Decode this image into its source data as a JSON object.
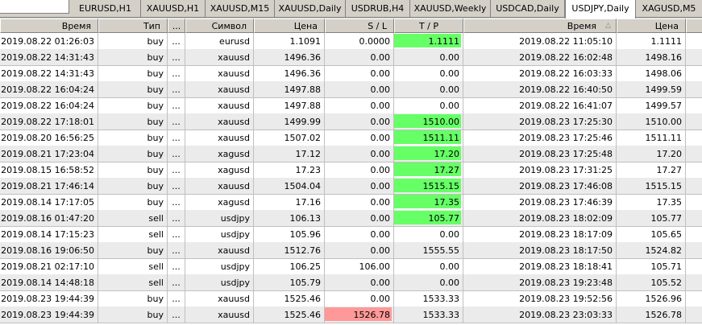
{
  "tabs": [
    {
      "label": "EURUSD,H1"
    },
    {
      "label": "XAUUSD,H1"
    },
    {
      "label": "XAUUSD,M15"
    },
    {
      "label": "XAUUSD,Daily"
    },
    {
      "label": "USDRUB,H4"
    },
    {
      "label": "XAUUSD,Weekly"
    },
    {
      "label": "USDCAD,Daily"
    },
    {
      "label": "USDJPY,Daily"
    },
    {
      "label": "XAGUSD,M5"
    }
  ],
  "active_tab": "USDJPY,Daily",
  "columns": [
    "Время",
    "Тип",
    "...",
    "Символ",
    "Цена",
    "S / L",
    "T / P",
    "Время",
    "Цена"
  ],
  "sorted_column_icon": "sort-up-icon",
  "colors": {
    "tp_hit": "#66ff66",
    "sl_hit": "#ff9999"
  },
  "rows": [
    {
      "open_time": "2019.08.22 01:26:03",
      "type": "buy",
      "dots": "...",
      "symbol": "eurusd",
      "price": "1.1091",
      "sl": "0.0000",
      "tp": "1.1111",
      "close_time": "2019.08.22 11:05:10",
      "close_price": "1.1111",
      "hl": "tp"
    },
    {
      "open_time": "2019.08.22 14:31:43",
      "type": "buy",
      "dots": "...",
      "symbol": "xauusd",
      "price": "1496.36",
      "sl": "0.00",
      "tp": "0.00",
      "close_time": "2019.08.22 16:02:48",
      "close_price": "1498.16",
      "hl": ""
    },
    {
      "open_time": "2019.08.22 14:31:43",
      "type": "buy",
      "dots": "...",
      "symbol": "xauusd",
      "price": "1496.36",
      "sl": "0.00",
      "tp": "0.00",
      "close_time": "2019.08.22 16:03:33",
      "close_price": "1498.06",
      "hl": ""
    },
    {
      "open_time": "2019.08.22 16:04:24",
      "type": "buy",
      "dots": "...",
      "symbol": "xauusd",
      "price": "1497.88",
      "sl": "0.00",
      "tp": "0.00",
      "close_time": "2019.08.22 16:40:50",
      "close_price": "1499.59",
      "hl": ""
    },
    {
      "open_time": "2019.08.22 16:04:24",
      "type": "buy",
      "dots": "...",
      "symbol": "xauusd",
      "price": "1497.88",
      "sl": "0.00",
      "tp": "0.00",
      "close_time": "2019.08.22 16:41:07",
      "close_price": "1499.57",
      "hl": ""
    },
    {
      "open_time": "2019.08.22 17:18:01",
      "type": "buy",
      "dots": "...",
      "symbol": "xauusd",
      "price": "1499.99",
      "sl": "0.00",
      "tp": "1510.00",
      "close_time": "2019.08.23 17:25:30",
      "close_price": "1510.00",
      "hl": "tp"
    },
    {
      "open_time": "2019.08.20 16:56:25",
      "type": "buy",
      "dots": "...",
      "symbol": "xauusd",
      "price": "1507.02",
      "sl": "0.00",
      "tp": "1511.11",
      "close_time": "2019.08.23 17:25:46",
      "close_price": "1511.11",
      "hl": "tp"
    },
    {
      "open_time": "2019.08.21 17:23:04",
      "type": "buy",
      "dots": "...",
      "symbol": "xagusd",
      "price": "17.12",
      "sl": "0.00",
      "tp": "17.20",
      "close_time": "2019.08.23 17:25:48",
      "close_price": "17.20",
      "hl": "tp"
    },
    {
      "open_time": "2019.08.15 16:58:52",
      "type": "buy",
      "dots": "...",
      "symbol": "xagusd",
      "price": "17.23",
      "sl": "0.00",
      "tp": "17.27",
      "close_time": "2019.08.23 17:31:25",
      "close_price": "17.27",
      "hl": "tp"
    },
    {
      "open_time": "2019.08.21 17:46:14",
      "type": "buy",
      "dots": "...",
      "symbol": "xauusd",
      "price": "1504.04",
      "sl": "0.00",
      "tp": "1515.15",
      "close_time": "2019.08.23 17:46:08",
      "close_price": "1515.15",
      "hl": "tp"
    },
    {
      "open_time": "2019.08.14 17:17:05",
      "type": "buy",
      "dots": "...",
      "symbol": "xagusd",
      "price": "17.16",
      "sl": "0.00",
      "tp": "17.35",
      "close_time": "2019.08.23 17:46:39",
      "close_price": "17.35",
      "hl": "tp"
    },
    {
      "open_time": "2019.08.16 01:47:20",
      "type": "sell",
      "dots": "...",
      "symbol": "usdjpy",
      "price": "106.13",
      "sl": "0.00",
      "tp": "105.77",
      "close_time": "2019.08.23 18:02:09",
      "close_price": "105.77",
      "hl": "tp"
    },
    {
      "open_time": "2019.08.14 17:15:23",
      "type": "sell",
      "dots": "...",
      "symbol": "usdjpy",
      "price": "105.96",
      "sl": "0.00",
      "tp": "0.00",
      "close_time": "2019.08.23 18:17:09",
      "close_price": "105.65",
      "hl": ""
    },
    {
      "open_time": "2019.08.16 19:06:50",
      "type": "buy",
      "dots": "...",
      "symbol": "xauusd",
      "price": "1512.76",
      "sl": "0.00",
      "tp": "1555.55",
      "close_time": "2019.08.23 18:17:50",
      "close_price": "1524.82",
      "hl": ""
    },
    {
      "open_time": "2019.08.21 02:17:10",
      "type": "sell",
      "dots": "...",
      "symbol": "usdjpy",
      "price": "106.25",
      "sl": "106.00",
      "tp": "0.00",
      "close_time": "2019.08.23 18:18:41",
      "close_price": "105.71",
      "hl": ""
    },
    {
      "open_time": "2019.08.14 14:48:18",
      "type": "sell",
      "dots": "...",
      "symbol": "usdjpy",
      "price": "105.79",
      "sl": "0.00",
      "tp": "0.00",
      "close_time": "2019.08.23 19:23:48",
      "close_price": "105.52",
      "hl": ""
    },
    {
      "open_time": "2019.08.23 19:44:39",
      "type": "buy",
      "dots": "...",
      "symbol": "xauusd",
      "price": "1525.46",
      "sl": "0.00",
      "tp": "1533.33",
      "close_time": "2019.08.23 19:52:56",
      "close_price": "1526.96",
      "hl": ""
    },
    {
      "open_time": "2019.08.23 19:44:39",
      "type": "buy",
      "dots": "...",
      "symbol": "xauusd",
      "price": "1525.46",
      "sl": "1526.78",
      "tp": "1533.33",
      "close_time": "2019.08.23 23:03:33",
      "close_price": "1526.78",
      "hl": "sl"
    }
  ]
}
